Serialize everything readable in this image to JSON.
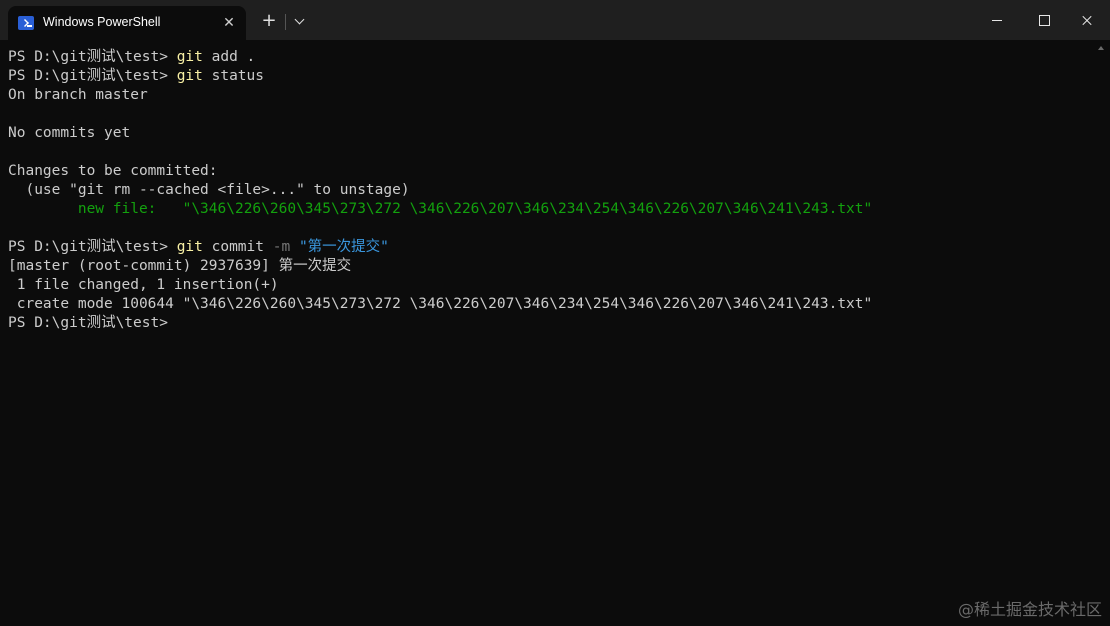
{
  "window": {
    "tab_title": "Windows PowerShell",
    "tab_close_glyph": "✕",
    "new_tab_glyph": "+"
  },
  "terminal": {
    "lines": [
      {
        "segments": [
          {
            "text": "PS D:\\git测试\\test> ",
            "color": "default"
          },
          {
            "text": "git",
            "color": "yellow"
          },
          {
            "text": " add .",
            "color": "default"
          }
        ]
      },
      {
        "segments": [
          {
            "text": "PS D:\\git测试\\test> ",
            "color": "default"
          },
          {
            "text": "git",
            "color": "yellow"
          },
          {
            "text": " status",
            "color": "default"
          }
        ]
      },
      {
        "segments": [
          {
            "text": "On branch master",
            "color": "default"
          }
        ]
      },
      {
        "segments": [
          {
            "text": "",
            "color": "default"
          }
        ]
      },
      {
        "segments": [
          {
            "text": "No commits yet",
            "color": "default"
          }
        ]
      },
      {
        "segments": [
          {
            "text": "",
            "color": "default"
          }
        ]
      },
      {
        "segments": [
          {
            "text": "Changes to be committed:",
            "color": "default"
          }
        ]
      },
      {
        "segments": [
          {
            "text": "  (use \"git rm --cached <file>...\" to unstage)",
            "color": "default"
          }
        ]
      },
      {
        "segments": [
          {
            "text": "        new file:   \"\\346\\226\\260\\345\\273\\272 \\346\\226\\207\\346\\234\\254\\346\\226\\207\\346\\241\\243.txt\"",
            "color": "green"
          }
        ]
      },
      {
        "segments": [
          {
            "text": "",
            "color": "default"
          }
        ]
      },
      {
        "segments": [
          {
            "text": "PS D:\\git测试\\test> ",
            "color": "default"
          },
          {
            "text": "git",
            "color": "yellow"
          },
          {
            "text": " commit ",
            "color": "default"
          },
          {
            "text": "-m",
            "color": "gray"
          },
          {
            "text": " ",
            "color": "default"
          },
          {
            "text": "\"第一次提交\"",
            "color": "cyan"
          }
        ]
      },
      {
        "segments": [
          {
            "text": "[master (root-commit) 2937639] 第一次提交",
            "color": "default"
          }
        ]
      },
      {
        "segments": [
          {
            "text": " 1 file changed, 1 insertion(+)",
            "color": "default"
          }
        ]
      },
      {
        "segments": [
          {
            "text": " create mode 100644 \"\\346\\226\\260\\345\\273\\272 \\346\\226\\207\\346\\234\\254\\346\\226\\207\\346\\241\\243.txt\"",
            "color": "default"
          }
        ]
      },
      {
        "segments": [
          {
            "text": "PS D:\\git测试\\test>",
            "color": "default"
          }
        ]
      }
    ]
  },
  "watermark": "@稀土掘金技术社区",
  "colors": {
    "background": "#0c0c0c",
    "titlebar": "#1f1f1f",
    "default_text": "#cccccc",
    "command_yellow": "#f9f1a5",
    "param_gray": "#767676",
    "string_cyan": "#3a96dd",
    "added_green": "#13a10e"
  }
}
